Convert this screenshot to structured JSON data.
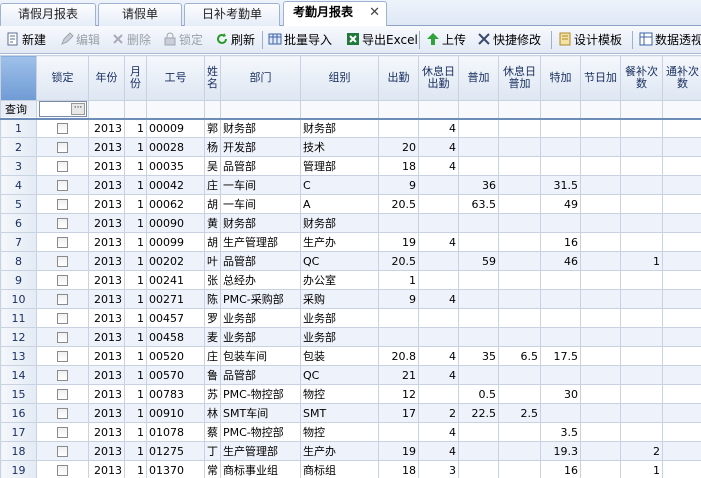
{
  "tabs": [
    {
      "label": "请假月报表",
      "active": false
    },
    {
      "label": "请假单",
      "active": false
    },
    {
      "label": "日补考勤单",
      "active": false
    },
    {
      "label": "考勤月报表",
      "active": true
    }
  ],
  "tab_close_glyph": "✕",
  "toolbar": {
    "new": "新建",
    "edit": "编辑",
    "delete": "删除",
    "lock": "锁定",
    "refresh": "刷新",
    "batch_import": "批量导入",
    "export_excel": "导出Excel",
    "upload": "上传",
    "quick_edit": "快捷修改",
    "design_template": "设计模板",
    "pivot": "数据透视"
  },
  "grid": {
    "columns": {
      "lock": "锁定",
      "year": "年份",
      "month": "月份",
      "emp_id": "工号",
      "name": "姓名",
      "dept": "部门",
      "group": "组别",
      "attendance": "出勤",
      "rest_attendance": "休息日出勤",
      "ot_normal": "普加",
      "ot_rest": "休息日普加",
      "ot_special": "特加",
      "ot_holiday": "节日加",
      "meal_count": "餐补次数",
      "travel_count": "通补次数"
    },
    "query_label": "查询",
    "query_btn": "···",
    "rows": [
      {
        "n": "1",
        "year": "2013",
        "month": "1",
        "emp_id": "00009",
        "name": "郭",
        "dept": "财务部",
        "group": "财务部",
        "attendance": "",
        "rest_attendance": "4",
        "ot_normal": "",
        "ot_rest": "",
        "ot_special": "",
        "ot_holiday": "",
        "meal_count": "",
        "travel_count": ""
      },
      {
        "n": "2",
        "year": "2013",
        "month": "1",
        "emp_id": "00028",
        "name": "杨",
        "dept": "开发部",
        "group": "技术",
        "attendance": "20",
        "rest_attendance": "4",
        "ot_normal": "",
        "ot_rest": "",
        "ot_special": "",
        "ot_holiday": "",
        "meal_count": "",
        "travel_count": ""
      },
      {
        "n": "3",
        "year": "2013",
        "month": "1",
        "emp_id": "00035",
        "name": "吴",
        "dept": "品管部",
        "group": "管理部",
        "attendance": "18",
        "rest_attendance": "4",
        "ot_normal": "",
        "ot_rest": "",
        "ot_special": "",
        "ot_holiday": "",
        "meal_count": "",
        "travel_count": ""
      },
      {
        "n": "4",
        "year": "2013",
        "month": "1",
        "emp_id": "00042",
        "name": "庄",
        "dept": "一车间",
        "group": "C",
        "attendance": "9",
        "rest_attendance": "",
        "ot_normal": "36",
        "ot_rest": "",
        "ot_special": "31.5",
        "ot_holiday": "",
        "meal_count": "",
        "travel_count": ""
      },
      {
        "n": "5",
        "year": "2013",
        "month": "1",
        "emp_id": "00062",
        "name": "胡",
        "dept": "一车间",
        "group": "A",
        "attendance": "20.5",
        "rest_attendance": "",
        "ot_normal": "63.5",
        "ot_rest": "",
        "ot_special": "49",
        "ot_holiday": "",
        "meal_count": "",
        "travel_count": ""
      },
      {
        "n": "6",
        "year": "2013",
        "month": "1",
        "emp_id": "00090",
        "name": "黄",
        "dept": "财务部",
        "group": "财务部",
        "attendance": "",
        "rest_attendance": "",
        "ot_normal": "",
        "ot_rest": "",
        "ot_special": "",
        "ot_holiday": "",
        "meal_count": "",
        "travel_count": ""
      },
      {
        "n": "7",
        "year": "2013",
        "month": "1",
        "emp_id": "00099",
        "name": "胡",
        "dept": "生产管理部",
        "group": "生产办",
        "attendance": "19",
        "rest_attendance": "4",
        "ot_normal": "",
        "ot_rest": "",
        "ot_special": "16",
        "ot_holiday": "",
        "meal_count": "",
        "travel_count": ""
      },
      {
        "n": "8",
        "year": "2013",
        "month": "1",
        "emp_id": "00202",
        "name": "叶",
        "dept": "品管部",
        "group": "QC",
        "attendance": "20.5",
        "rest_attendance": "",
        "ot_normal": "59",
        "ot_rest": "",
        "ot_special": "46",
        "ot_holiday": "",
        "meal_count": "1",
        "travel_count": ""
      },
      {
        "n": "9",
        "year": "2013",
        "month": "1",
        "emp_id": "00241",
        "name": "张",
        "dept": "总经办",
        "group": "办公室",
        "attendance": "1",
        "rest_attendance": "",
        "ot_normal": "",
        "ot_rest": "",
        "ot_special": "",
        "ot_holiday": "",
        "meal_count": "",
        "travel_count": ""
      },
      {
        "n": "10",
        "year": "2013",
        "month": "1",
        "emp_id": "00271",
        "name": "陈",
        "dept": "PMC-采购部",
        "group": "采购",
        "attendance": "9",
        "rest_attendance": "4",
        "ot_normal": "",
        "ot_rest": "",
        "ot_special": "",
        "ot_holiday": "",
        "meal_count": "",
        "travel_count": ""
      },
      {
        "n": "11",
        "year": "2013",
        "month": "1",
        "emp_id": "00457",
        "name": "罗",
        "dept": "业务部",
        "group": "业务部",
        "attendance": "",
        "rest_attendance": "",
        "ot_normal": "",
        "ot_rest": "",
        "ot_special": "",
        "ot_holiday": "",
        "meal_count": "",
        "travel_count": ""
      },
      {
        "n": "12",
        "year": "2013",
        "month": "1",
        "emp_id": "00458",
        "name": "麦",
        "dept": "业务部",
        "group": "业务部",
        "attendance": "",
        "rest_attendance": "",
        "ot_normal": "",
        "ot_rest": "",
        "ot_special": "",
        "ot_holiday": "",
        "meal_count": "",
        "travel_count": ""
      },
      {
        "n": "13",
        "year": "2013",
        "month": "1",
        "emp_id": "00520",
        "name": "庄",
        "dept": "包装车间",
        "group": "包装",
        "attendance": "20.8",
        "rest_attendance": "4",
        "ot_normal": "35",
        "ot_rest": "6.5",
        "ot_special": "17.5",
        "ot_holiday": "",
        "meal_count": "",
        "travel_count": ""
      },
      {
        "n": "14",
        "year": "2013",
        "month": "1",
        "emp_id": "00570",
        "name": "鲁",
        "dept": "品管部",
        "group": "QC",
        "attendance": "21",
        "rest_attendance": "4",
        "ot_normal": "",
        "ot_rest": "",
        "ot_special": "",
        "ot_holiday": "",
        "meal_count": "",
        "travel_count": ""
      },
      {
        "n": "15",
        "year": "2013",
        "month": "1",
        "emp_id": "00783",
        "name": "苏",
        "dept": "PMC-物控部",
        "group": "物控",
        "attendance": "12",
        "rest_attendance": "",
        "ot_normal": "0.5",
        "ot_rest": "",
        "ot_special": "30",
        "ot_holiday": "",
        "meal_count": "",
        "travel_count": ""
      },
      {
        "n": "16",
        "year": "2013",
        "month": "1",
        "emp_id": "00910",
        "name": "林",
        "dept": "SMT车间",
        "group": "SMT",
        "attendance": "17",
        "rest_attendance": "2",
        "ot_normal": "22.5",
        "ot_rest": "2.5",
        "ot_special": "",
        "ot_holiday": "",
        "meal_count": "",
        "travel_count": ""
      },
      {
        "n": "17",
        "year": "2013",
        "month": "1",
        "emp_id": "01078",
        "name": "蔡",
        "dept": "PMC-物控部",
        "group": "物控",
        "attendance": "",
        "rest_attendance": "4",
        "ot_normal": "",
        "ot_rest": "",
        "ot_special": "3.5",
        "ot_holiday": "",
        "meal_count": "",
        "travel_count": ""
      },
      {
        "n": "18",
        "year": "2013",
        "month": "1",
        "emp_id": "01275",
        "name": "丁",
        "dept": "生产管理部",
        "group": "生产办",
        "attendance": "19",
        "rest_attendance": "4",
        "ot_normal": "",
        "ot_rest": "",
        "ot_special": "19.3",
        "ot_holiday": "",
        "meal_count": "2",
        "travel_count": ""
      },
      {
        "n": "19",
        "year": "2013",
        "month": "1",
        "emp_id": "01370",
        "name": "常",
        "dept": "商标事业组",
        "group": "商标组",
        "attendance": "18",
        "rest_attendance": "3",
        "ot_normal": "",
        "ot_rest": "",
        "ot_special": "16",
        "ot_holiday": "",
        "meal_count": "1",
        "travel_count": ""
      }
    ]
  },
  "colors": {
    "header_start": "#f5f8fc",
    "header_end": "#dde6f2",
    "alt_row": "#eef2fa",
    "grid_line": "#c8d2e0"
  }
}
